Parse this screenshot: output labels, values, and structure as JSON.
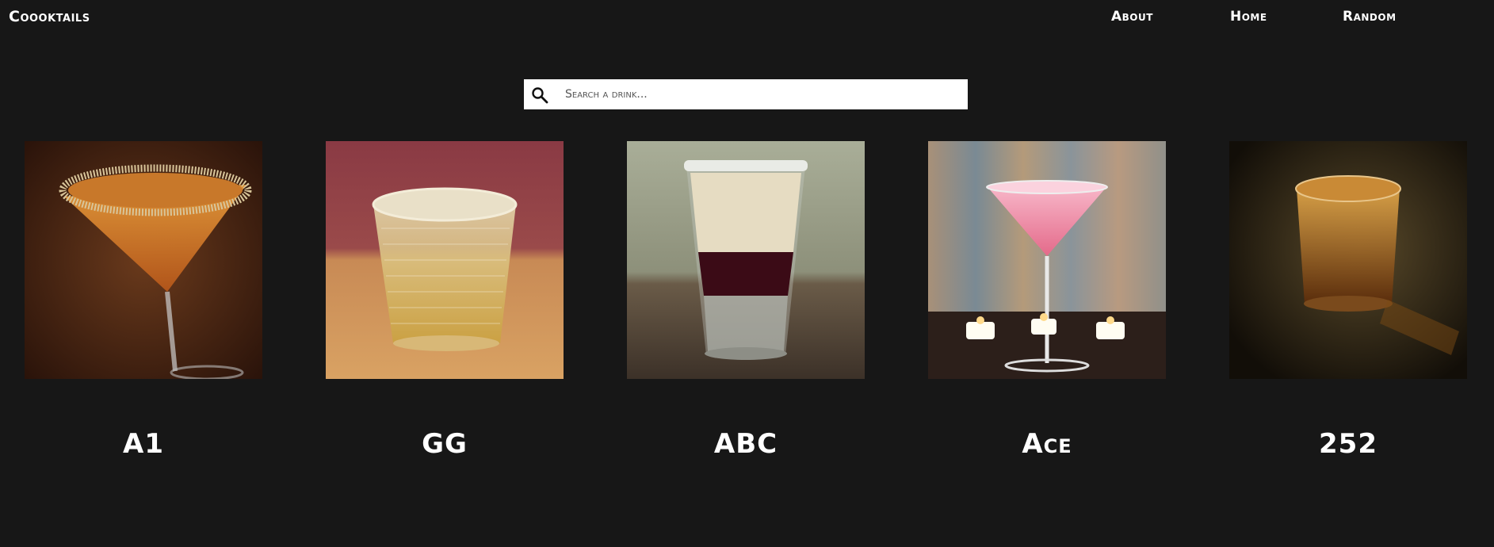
{
  "nav": {
    "logo": "Coooktails",
    "links": [
      {
        "label": "About"
      },
      {
        "label": "Home"
      },
      {
        "label": "Random"
      }
    ]
  },
  "search": {
    "placeholder": "Search a drink...",
    "value": ""
  },
  "drinks": [
    {
      "name": "A1",
      "image": "drink-photo-cocktail-glass-orange"
    },
    {
      "name": "GG",
      "image": "drink-photo-tumbler-yellow"
    },
    {
      "name": "ABC",
      "image": "drink-photo-layered-shot"
    },
    {
      "name": "Ace",
      "image": "drink-photo-cocktail-glass-pink"
    },
    {
      "name": "252",
      "image": "drink-photo-shot-glass-amber"
    }
  ],
  "colors": {
    "background": "#171717",
    "text": "#ffffff",
    "search_bg": "#ffffff"
  }
}
